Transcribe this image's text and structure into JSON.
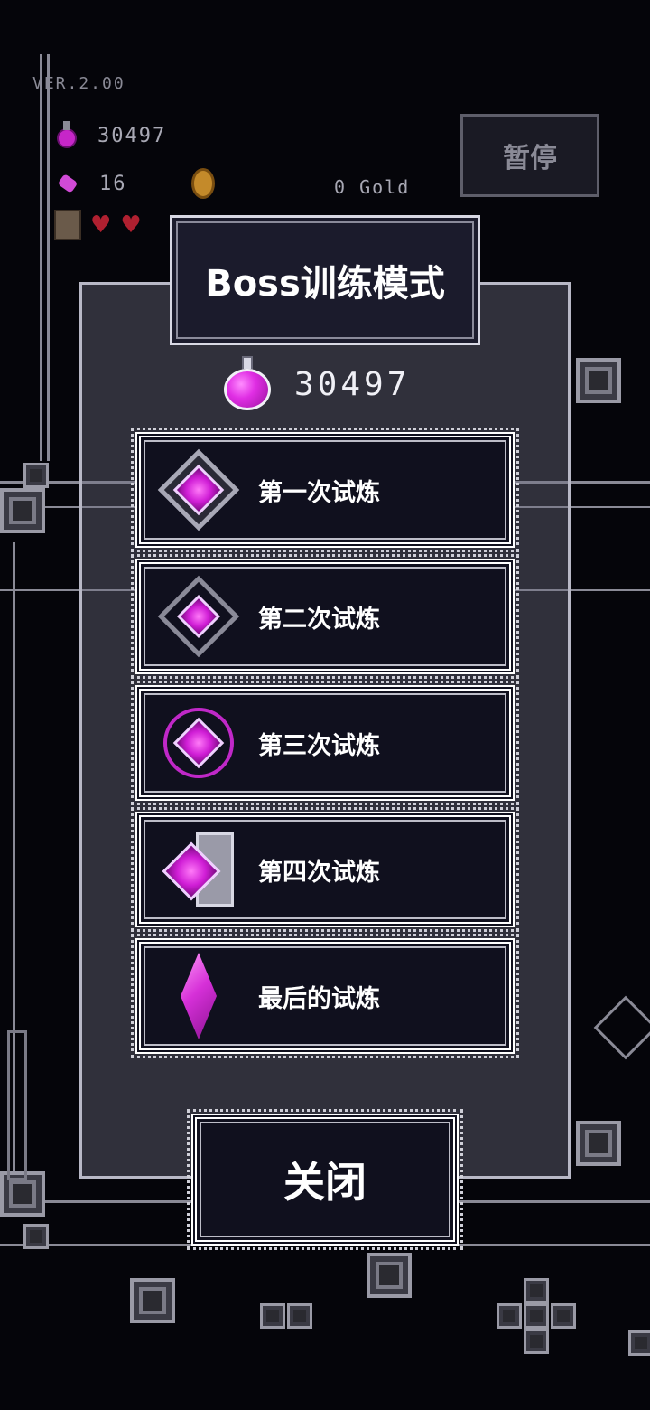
{
  "hud": {
    "version": "VER.2.00",
    "gems": "30497",
    "candies": "16",
    "gold": "0 Gold",
    "pause_label": "暂停",
    "hearts": [
      "♥",
      "♥"
    ]
  },
  "modal": {
    "title": "Boss训练模式",
    "gem_count": "30497",
    "trials": [
      {
        "label": "第一次试炼",
        "icon": "crystal-frame-square-icon"
      },
      {
        "label": "第二次试炼",
        "icon": "crystal-frame-diamond-icon"
      },
      {
        "label": "第三次试炼",
        "icon": "crystal-frame-ring-icon"
      },
      {
        "label": "第四次试炼",
        "icon": "crystal-frame-pillar-icon"
      },
      {
        "label": "最后的试炼",
        "icon": "pink-crystal-icon"
      }
    ],
    "close_label": "关闭"
  },
  "colors": {
    "accent_magenta": "#d01ed6",
    "panel_border": "#b8b8c6",
    "button_bg": "#10101e"
  }
}
